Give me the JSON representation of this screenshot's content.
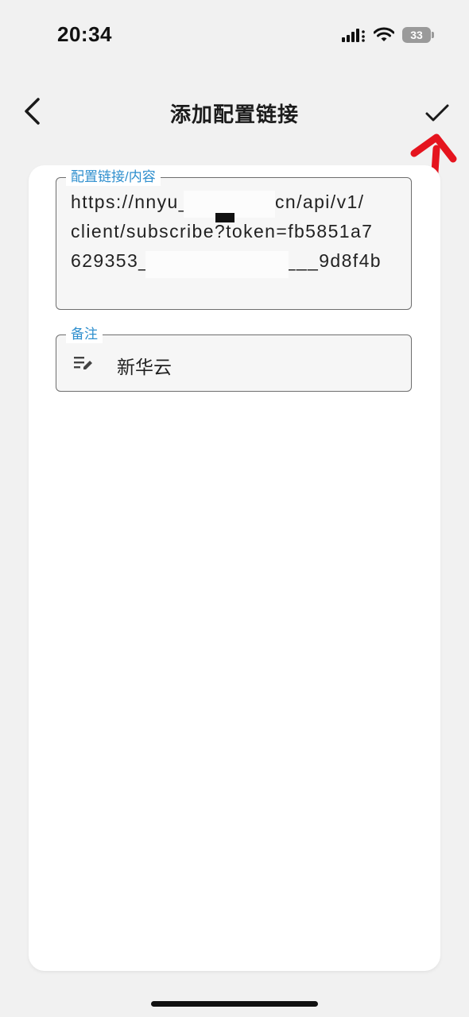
{
  "status_bar": {
    "time": "20:34",
    "battery": "33"
  },
  "header": {
    "title": "添加配置链接",
    "back_icon": "chevron-left-icon",
    "confirm_icon": "checkmark-icon"
  },
  "form": {
    "url_field": {
      "label": "配置链接/内容",
      "value": "https://nnyu________.cn/api/v1/\nclient/subscribe?token=fb5851a7\n629353________________9d8f4b"
    },
    "note_field": {
      "label": "备注",
      "icon": "edit-note-icon",
      "value": "新华云"
    }
  },
  "colors": {
    "accent_label": "#2f8fce",
    "annotation_arrow": "#e5141e",
    "background": "#f1f1f1",
    "card": "#ffffff"
  }
}
